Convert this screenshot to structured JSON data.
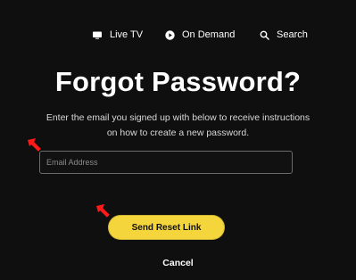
{
  "nav": {
    "items": [
      {
        "label": "Live TV",
        "icon": "tv-icon"
      },
      {
        "label": "On Demand",
        "icon": "play-circle-icon"
      },
      {
        "label": "Search",
        "icon": "search-icon"
      }
    ]
  },
  "page": {
    "title": "Forgot Password?",
    "instructions": "Enter the email you signed up with below to receive instructions on how to create a new password."
  },
  "form": {
    "email_placeholder": "Email Address",
    "email_value": "",
    "send_label": "Send Reset Link",
    "cancel_label": "Cancel"
  },
  "colors": {
    "background": "#0f0f0f",
    "accent": "#f5d53c",
    "marker": "#ff1a1a"
  }
}
